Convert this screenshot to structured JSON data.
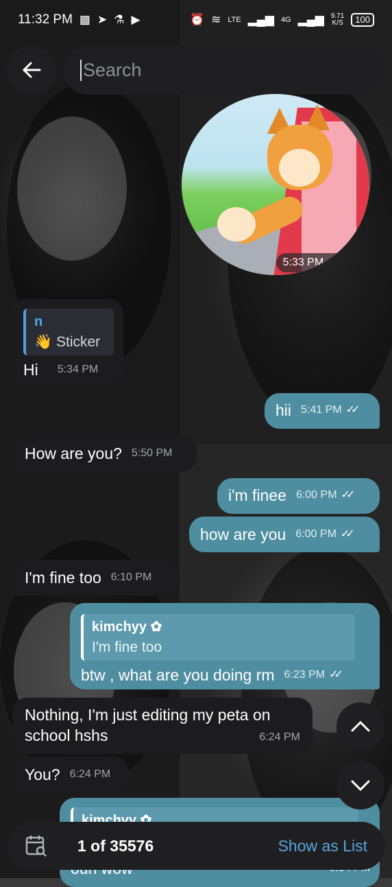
{
  "status_bar": {
    "time": "11:32 PM",
    "network_lte": "LTE",
    "network_4g": "4G",
    "speed_value": "9.71",
    "speed_unit": "K/S",
    "battery": "100"
  },
  "search": {
    "placeholder": "Search"
  },
  "sticker": {
    "time": "5:33 PM"
  },
  "messages": [
    {
      "reply_name": "n",
      "reply_text": "👋 Sticker",
      "text": "Hi",
      "time": "5:34 PM"
    },
    {
      "text": "hii",
      "time": "5:41 PM"
    },
    {
      "text": "How are you?",
      "time": "5:50 PM"
    },
    {
      "text": "i'm finee",
      "time": "6:00 PM"
    },
    {
      "text": "how are you",
      "time": "6:00 PM"
    },
    {
      "text": "I'm fine too",
      "time": "6:10 PM"
    },
    {
      "reply_name": "kimchyy ✿",
      "reply_text": "I'm fine too",
      "text": "btw , what are you doing rm",
      "time": "6:23 PM"
    },
    {
      "text": "Nothing, I'm just editing my peta on school hshs",
      "time": "6:24 PM"
    },
    {
      "text": "You?",
      "time": "6:24 PM"
    },
    {
      "reply_name": "kimchyy ✿",
      "text": "ouh wow",
      "time": "6:54 PM"
    }
  ],
  "bottom_bar": {
    "result_count": "1 of 35576",
    "show_as_list": "Show as List"
  },
  "colors": {
    "incoming_bubble": "#1c1c1e",
    "outgoing_bubble": "#4f8da1",
    "accent": "#5aa7e0"
  }
}
